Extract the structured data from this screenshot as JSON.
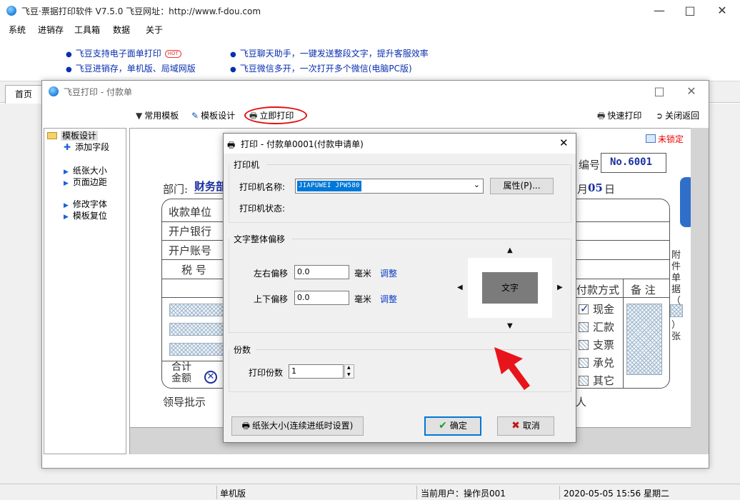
{
  "main_window": {
    "title": "飞豆·票据打印软件 V7.5.0   飞豆网址：http://www.f-dou.com",
    "menu": [
      "系统",
      "进销存",
      "工具箱",
      "数据",
      "关于"
    ],
    "ads": [
      {
        "text": "飞豆支持电子面单打印",
        "badge": "HOT"
      },
      {
        "text": "飞豆聊天助手，一键发送整段文字，提升客服效率"
      },
      {
        "text": "飞豆进销存，单机版、局域网版"
      },
      {
        "text": "飞豆微信多开，一次打开多个微信(电脑PC版)"
      }
    ],
    "tab": "首页",
    "status": {
      "mode": "单机版",
      "user": "当前用户：操作员001",
      "datetime": "2020-05-05  15:56  星期二"
    }
  },
  "payment_window": {
    "title": "飞豆打印 - 付款单",
    "toolbar": {
      "templates": "常用模板",
      "design": "模板设计",
      "print_now": "立即打印",
      "quick_print": "快速打印",
      "close_return": "关闭返回"
    },
    "tree": {
      "root": "模板设计",
      "items": [
        "添加字段",
        "纸张大小",
        "页面边距",
        "修改字体",
        "模板复位"
      ]
    },
    "voucher": {
      "lock_label": "未锁定",
      "number_label": "编号",
      "number": "No.6001",
      "dept_label": "部门:",
      "dept_value": "财务部",
      "day": "05",
      "day_unit": "日",
      "rows": [
        "收款单位",
        "开户银行",
        "开户账号",
        "税 号"
      ],
      "pay_method_header": "付款方式",
      "remark_header": "备 注",
      "pay_methods": [
        "现金",
        "汇款",
        "支票",
        "承兑",
        "其它"
      ],
      "total_label_1": "合计",
      "total_label_2": "金额",
      "leader_label": "领导批示",
      "person_suffix": "人",
      "side_text": [
        "附",
        "件",
        "单",
        "据",
        "（",
        "）",
        "张"
      ]
    }
  },
  "print_dialog": {
    "title": "打印 - 付款单0001(付款申请单)",
    "printer_group": "打印机",
    "printer_name_label": "打印机名称:",
    "printer_name_value": "JIAPUWEI JPW580",
    "properties_button": "属性(P)...",
    "printer_status_label": "打印机状态:",
    "offset_group": "文字整体偏移",
    "h_offset_label": "左右偏移",
    "h_offset_value": "0.0",
    "v_offset_label": "上下偏移",
    "v_offset_value": "0.0",
    "unit": "毫米",
    "adjust_link": "调整",
    "preview_text": "文字",
    "copies_group": "份数",
    "copies_label": "打印份数",
    "copies_value": "1",
    "paper_button": "纸张大小(连续进纸时设置)",
    "ok_button": "确定",
    "cancel_button": "取消"
  },
  "colors": {
    "accent": "#0078d7",
    "link": "#0a3ec6",
    "annotation_red": "#e01010",
    "voucher_blue": "#1a2fa0"
  }
}
